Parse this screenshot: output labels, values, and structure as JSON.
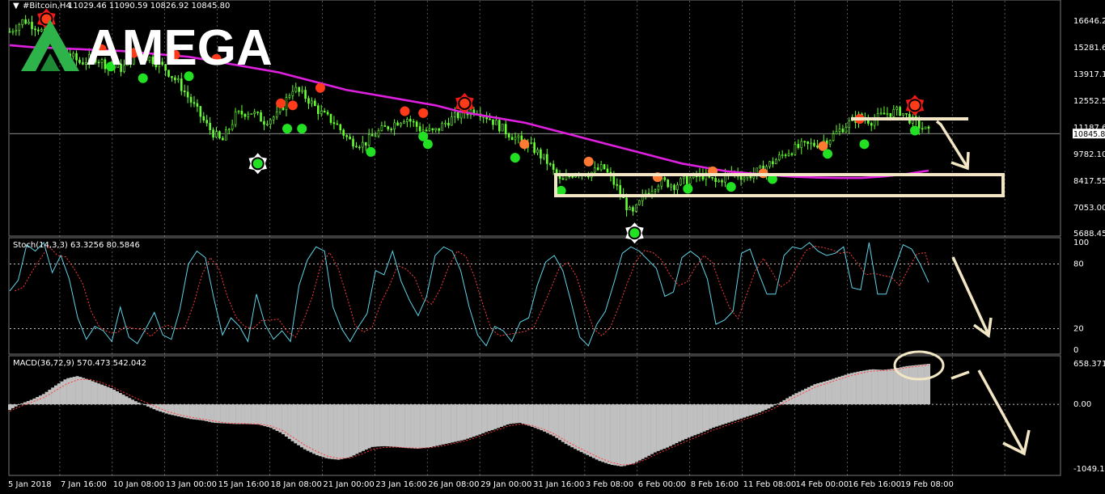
{
  "header": {
    "symbol": "#Bitcoin,H4",
    "ohlc": "11029.46 11090.59 10826.92 10845.80"
  },
  "brand": {
    "name": "AMEGA",
    "logo_color": "#2db34a"
  },
  "colors": {
    "background": "#000000",
    "candles": "#66ff33",
    "ma": "#e020e0",
    "sell_dot": "#ff3b1a",
    "sell_dot_light": "#ff7b33",
    "buy_dot": "#22e022",
    "stoch_main": "#5fd3e8",
    "stoch_signal": "#ff3b3b",
    "macd_hist": "#c0c0c0",
    "macd_signal": "#ff3b3b",
    "annotation": "#f2e6c4",
    "grid": "#ffffff"
  },
  "chart_data": [
    {
      "type": "line",
      "label": "#Bitcoin,H4",
      "x_labels": [
        "5 Jan 2018",
        "7 Jan 16:00",
        "10 Jan 08:00",
        "13 Jan 00:00",
        "15 Jan 16:00",
        "18 Jan 08:00",
        "21 Jan 00:00",
        "23 Jan 16:00",
        "26 Jan 08:00",
        "29 Jan 00:00",
        "31 Jan 16:00",
        "3 Feb 08:00",
        "6 Feb 00:00",
        "8 Feb 16:00",
        "11 Feb 08:00",
        "14 Feb 00:00",
        "16 Feb 16:00",
        "19 Feb 08:00"
      ],
      "y_ticks": [
        "16646.20",
        "15281.65",
        "13917.10",
        "12552.55",
        "11187.65",
        "9782.10",
        "8417.55",
        "7053.00",
        "5688.45"
      ],
      "current_price": "10845.80",
      "ylim": [
        5688.45,
        16646.2
      ],
      "price_series": [
        16100,
        16700,
        16300,
        15600,
        15000,
        14500,
        14800,
        14300,
        14200,
        15000,
        14700,
        14200,
        13400,
        12300,
        11200,
        10400,
        11800,
        12000,
        11500,
        11800,
        13200,
        12700,
        11900,
        11400,
        10500,
        10300,
        10900,
        11300,
        11700,
        11100,
        10900,
        11500,
        11900,
        12100,
        11600,
        11000,
        10500,
        10100,
        9400,
        8300,
        8900,
        8800,
        9100,
        8000,
        6600,
        7800,
        8400,
        8200,
        8500,
        8700,
        8300,
        8900,
        8600,
        8900,
        9400,
        9900,
        10200,
        10300,
        10600,
        11200,
        11700,
        11500,
        11900,
        12000,
        11400,
        10900
      ],
      "ma_series": [
        15400,
        15300,
        15250,
        15200,
        15150,
        15100,
        15000,
        14900,
        14800,
        14600,
        14400,
        14200,
        14000,
        13700,
        13400,
        13100,
        12900,
        12700,
        12500,
        12300,
        12000,
        11800,
        11600,
        11400,
        11100,
        10800,
        10500,
        10200,
        9900,
        9600,
        9300,
        9100,
        8900,
        8800,
        8700,
        8620,
        8580,
        8560,
        8560,
        8640,
        8760,
        8940
      ],
      "signals": [
        {
          "side": "sell",
          "pos": 0.04,
          "value": 16750,
          "big": true
        },
        {
          "side": "sell",
          "pos": 0.1,
          "value": 15200
        },
        {
          "side": "sell",
          "pos": 0.135,
          "value": 15000
        },
        {
          "side": "sell",
          "pos": 0.18,
          "value": 14900
        },
        {
          "side": "sell",
          "pos": 0.225,
          "value": 14700
        },
        {
          "side": "sell",
          "pos": 0.295,
          "value": 12400
        },
        {
          "side": "sell",
          "pos": 0.308,
          "value": 12300
        },
        {
          "side": "sell",
          "pos": 0.338,
          "value": 13200
        },
        {
          "side": "sell",
          "pos": 0.43,
          "value": 12000
        },
        {
          "side": "sell",
          "pos": 0.45,
          "value": 11900
        },
        {
          "side": "sell",
          "pos": 0.495,
          "value": 12400,
          "big": true
        },
        {
          "side": "sell",
          "pos": 0.56,
          "value": 10300
        },
        {
          "side": "sell",
          "pos": 0.63,
          "value": 9400
        },
        {
          "side": "sell",
          "pos": 0.705,
          "value": 8600
        },
        {
          "side": "sell",
          "pos": 0.765,
          "value": 8900
        },
        {
          "side": "sell",
          "pos": 0.82,
          "value": 8800
        },
        {
          "side": "sell",
          "pos": 0.885,
          "value": 10200
        },
        {
          "side": "sell",
          "pos": 0.925,
          "value": 11600
        },
        {
          "side": "sell",
          "pos": 0.985,
          "value": 12300,
          "big": true
        },
        {
          "side": "buy",
          "pos": 0.11,
          "value": 14300
        },
        {
          "side": "buy",
          "pos": 0.145,
          "value": 13700
        },
        {
          "side": "buy",
          "pos": 0.195,
          "value": 13800
        },
        {
          "side": "buy",
          "pos": 0.27,
          "value": 9300,
          "big": true
        },
        {
          "side": "buy",
          "pos": 0.302,
          "value": 11100
        },
        {
          "side": "buy",
          "pos": 0.318,
          "value": 11100
        },
        {
          "side": "buy",
          "pos": 0.393,
          "value": 9900
        },
        {
          "side": "buy",
          "pos": 0.45,
          "value": 10700
        },
        {
          "side": "buy",
          "pos": 0.455,
          "value": 10300
        },
        {
          "side": "buy",
          "pos": 0.55,
          "value": 9600
        },
        {
          "side": "buy",
          "pos": 0.6,
          "value": 7900
        },
        {
          "side": "buy",
          "pos": 0.68,
          "value": 5720,
          "big": true
        },
        {
          "side": "buy",
          "pos": 0.738,
          "value": 8000
        },
        {
          "side": "buy",
          "pos": 0.785,
          "value": 8100
        },
        {
          "side": "buy",
          "pos": 0.83,
          "value": 8500
        },
        {
          "side": "buy",
          "pos": 0.89,
          "value": 9800
        },
        {
          "side": "buy",
          "pos": 0.93,
          "value": 10300
        },
        {
          "side": "buy",
          "pos": 0.985,
          "value": 11000
        }
      ]
    },
    {
      "type": "line",
      "label": "Stoch(14,3,3) 63.3256 80.5846",
      "y_ticks": [
        "100",
        "80",
        "20",
        "0"
      ],
      "ylim": [
        0,
        100
      ],
      "values": [
        55,
        65,
        98,
        92,
        100,
        72,
        88,
        66,
        30,
        10,
        22,
        18,
        8,
        40,
        12,
        6,
        20,
        35,
        14,
        10,
        38,
        80,
        92,
        86,
        48,
        14,
        30,
        22,
        8,
        52,
        24,
        10,
        18,
        8,
        60,
        84,
        96,
        92,
        40,
        20,
        8,
        22,
        34,
        74,
        70,
        92,
        64,
        46,
        32,
        50,
        88,
        96,
        92,
        74,
        40,
        14,
        4,
        22,
        18,
        8,
        26,
        30,
        60,
        82,
        88,
        74,
        44,
        12,
        4,
        24,
        36,
        62,
        90,
        96,
        92,
        84,
        76,
        50,
        54,
        86,
        92,
        86,
        66,
        24,
        28,
        36,
        90,
        94,
        72,
        52,
        52,
        88,
        96,
        94,
        100,
        92,
        88,
        90,
        96,
        58,
        56,
        100,
        52,
        52,
        76,
        98,
        94,
        80,
        63
      ]
    },
    {
      "type": "area",
      "label": "MACD(36,72,9) 570.473 542.042",
      "y_ticks": [
        "658.371",
        "0.00",
        "-1049.17"
      ],
      "ylim": [
        -1049.17,
        658.371
      ],
      "values": [
        -90,
        10,
        80,
        170,
        300,
        420,
        460,
        400,
        330,
        260,
        160,
        60,
        -20,
        -100,
        -160,
        -200,
        -240,
        -260,
        -300,
        -310,
        -320,
        -320,
        -330,
        -380,
        -470,
        -610,
        -730,
        -820,
        -880,
        -900,
        -860,
        -770,
        -690,
        -680,
        -690,
        -710,
        -720,
        -700,
        -660,
        -620,
        -580,
        -520,
        -450,
        -390,
        -320,
        -300,
        -360,
        -430,
        -520,
        -640,
        -740,
        -830,
        -920,
        -980,
        -1010,
        -960,
        -870,
        -770,
        -700,
        -610,
        -530,
        -460,
        -380,
        -320,
        -260,
        -200,
        -140,
        -60,
        40,
        150,
        240,
        330,
        380,
        440,
        500,
        540,
        570,
        560,
        580,
        620,
        640,
        658
      ],
      "signal": [
        -110,
        -30,
        40,
        110,
        220,
        330,
        400,
        410,
        360,
        290,
        200,
        110,
        30,
        -50,
        -120,
        -170,
        -210,
        -240,
        -270,
        -300,
        -310,
        -315,
        -320,
        -350,
        -420,
        -540,
        -660,
        -760,
        -840,
        -880,
        -870,
        -810,
        -730,
        -700,
        -695,
        -705,
        -712,
        -705,
        -680,
        -640,
        -600,
        -545,
        -480,
        -415,
        -350,
        -320,
        -340,
        -400,
        -480,
        -590,
        -690,
        -780,
        -870,
        -940,
        -985,
        -970,
        -900,
        -810,
        -730,
        -650,
        -570,
        -495,
        -420,
        -355,
        -290,
        -230,
        -170,
        -100,
        0,
        100,
        190,
        280,
        340,
        400,
        460,
        505,
        540,
        550,
        560,
        595,
        620,
        640
      ]
    }
  ]
}
